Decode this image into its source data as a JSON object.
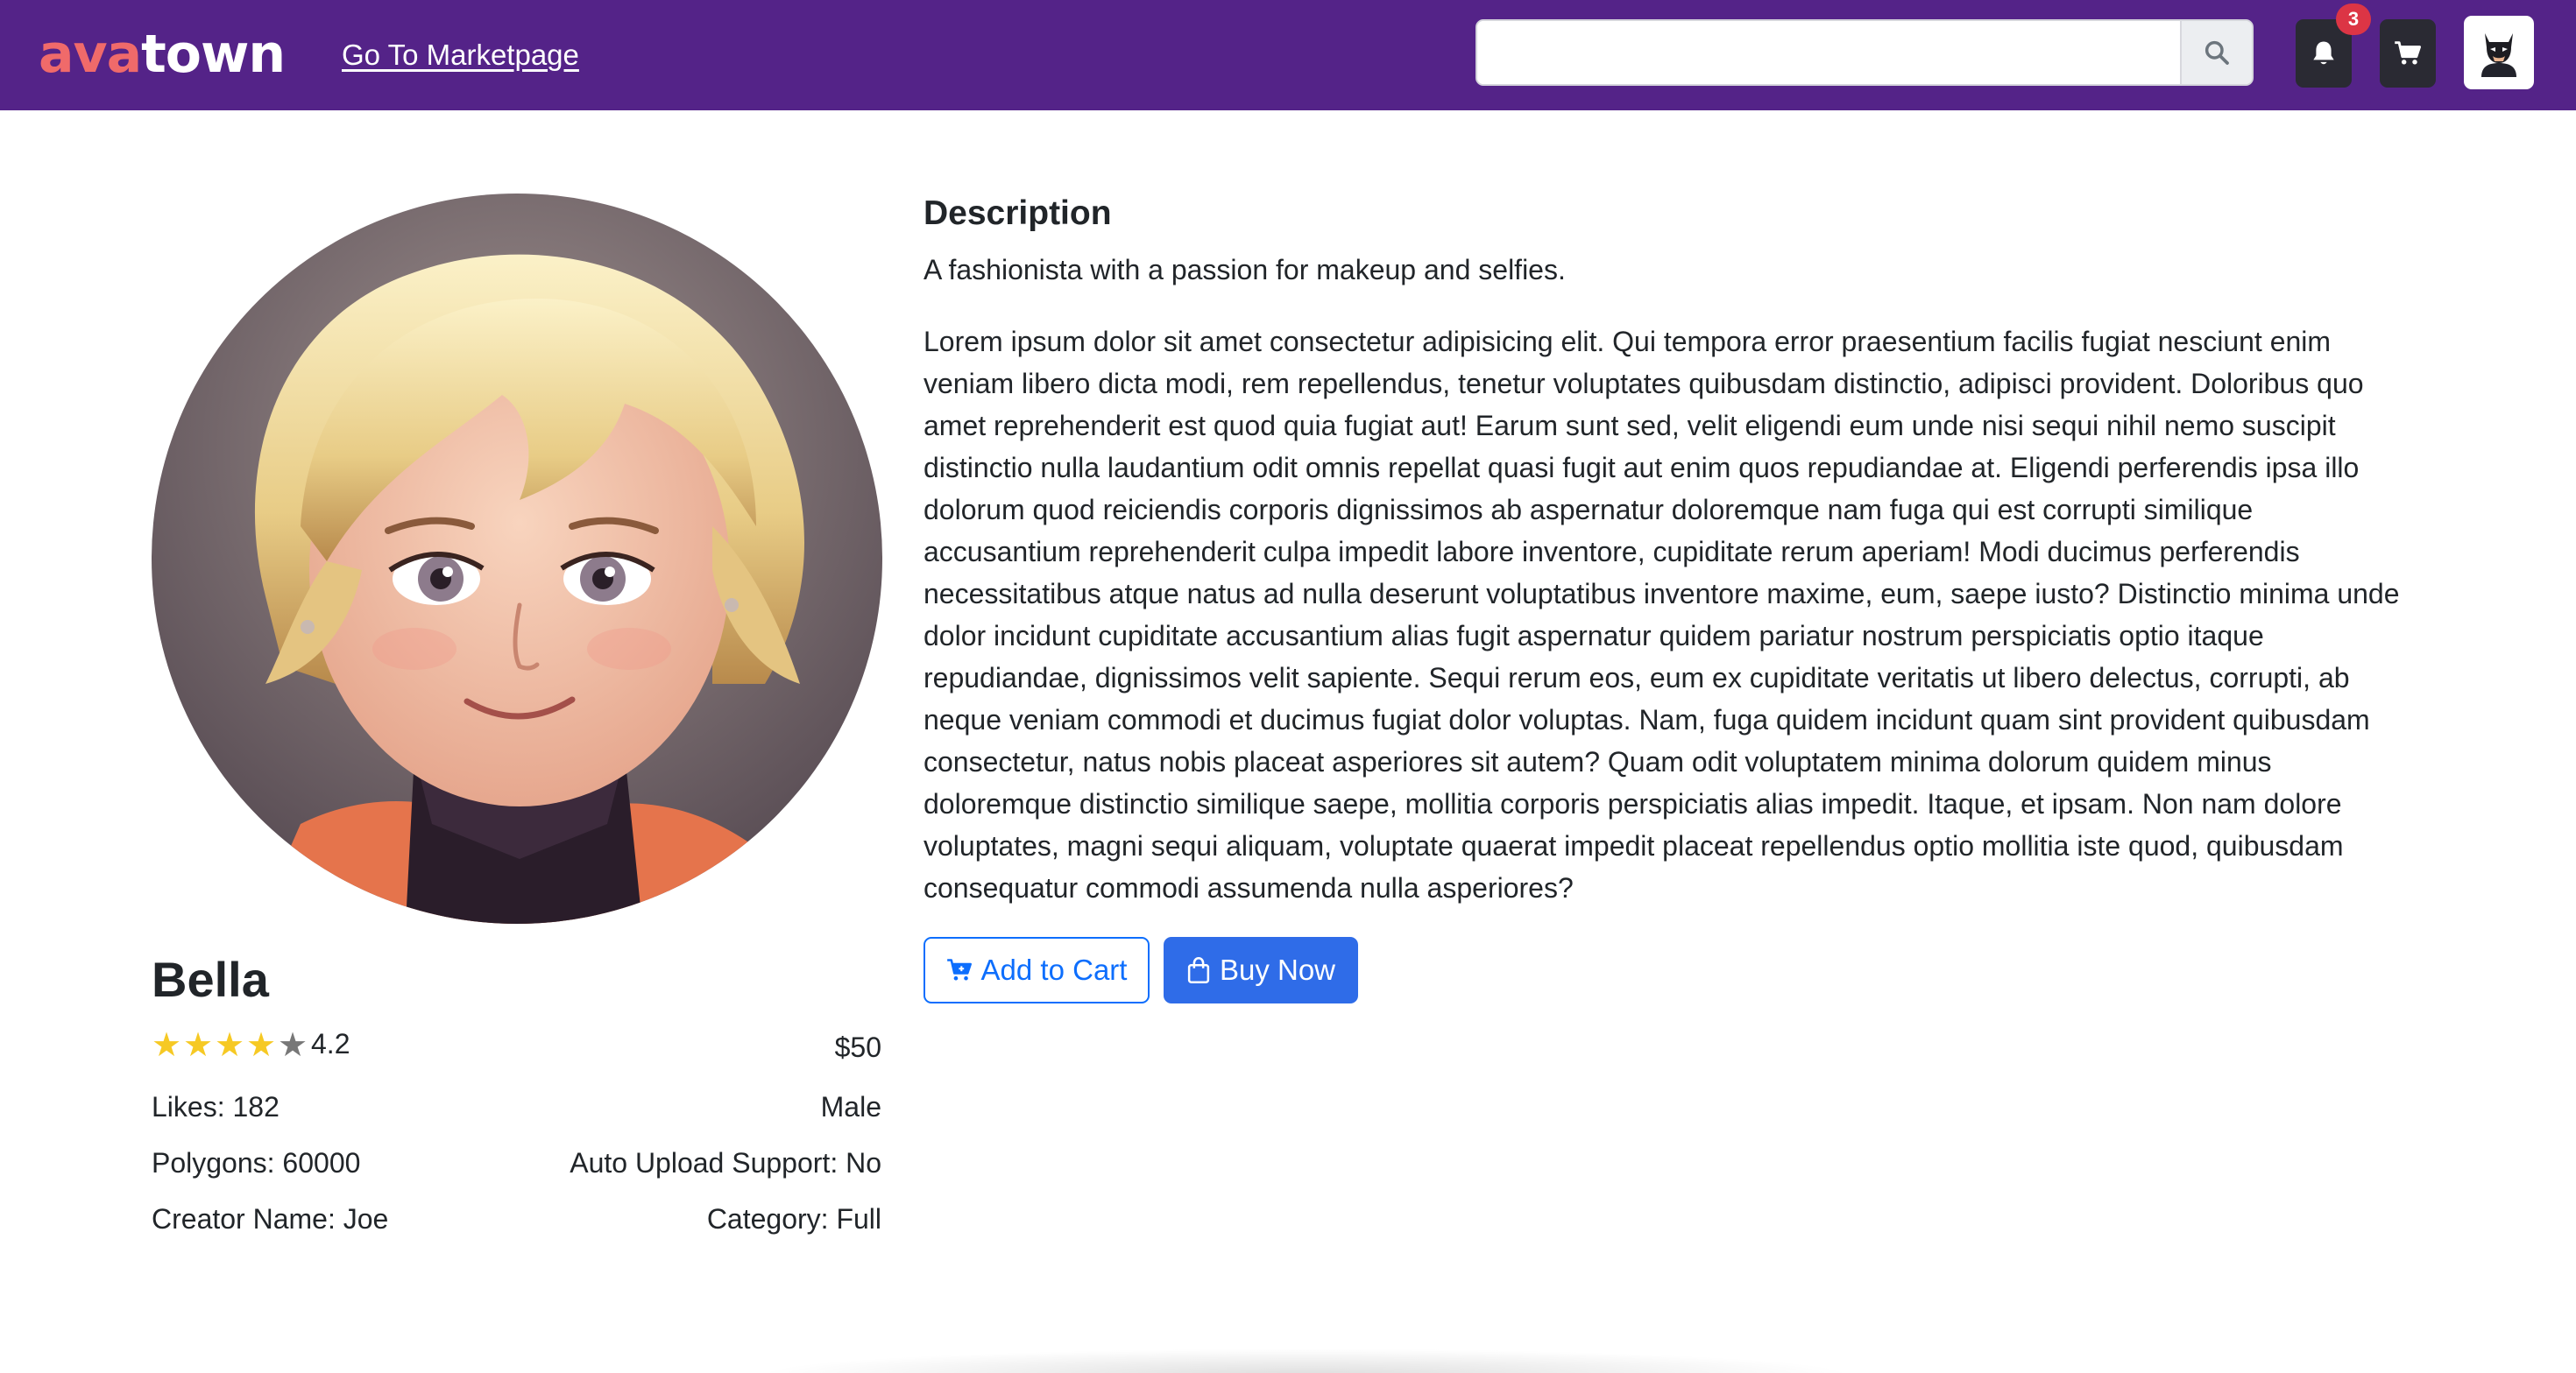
{
  "colors": {
    "navbar": "#542388",
    "logo_accent": "#f06a6a",
    "primary": "#0d6efd",
    "badge": "#dc3545",
    "star_on": "#f6c924",
    "star_off": "#777777"
  },
  "header": {
    "logo_part1": "ava",
    "logo_part2": "town",
    "marketplace_link": "Go To Marketpage",
    "search": {
      "value": "",
      "placeholder": "",
      "icon": "search-icon"
    },
    "notifications": {
      "icon": "bell-icon",
      "count": "3"
    },
    "cart": {
      "icon": "cart-icon"
    },
    "user_avatar": {
      "icon": "batman-avatar-icon"
    }
  },
  "product": {
    "name": "Bella",
    "rating": 4.2,
    "rating_label": "4.2",
    "rating_max": 5,
    "stars_filled": 4,
    "price": "$50",
    "likes": "Likes: 182",
    "gender": "Male",
    "polygons": "Polygons: 60000",
    "auto_upload": "Auto Upload Support: No",
    "creator": "Creator Name: Joe",
    "category": "Category: Full",
    "image": "cartoon-avatar-portrait"
  },
  "description": {
    "title": "Description",
    "tagline": "A fashionista with a passion for makeup and selfies.",
    "body": "Lorem ipsum dolor sit amet consectetur adipisicing elit. Qui tempora error praesentium facilis fugiat nesciunt enim veniam libero dicta modi, rem repellendus, tenetur voluptates quibusdam distinctio, adipisci provident. Doloribus quo amet reprehenderit est quod quia fugiat aut! Earum sunt sed, velit eligendi eum unde nisi sequi nihil nemo suscipit distinctio nulla laudantium odit omnis repellat quasi fugit aut enim quos repudiandae at. Eligendi perferendis ipsa illo dolorum quod reiciendis corporis dignissimos ab aspernatur doloremque nam fuga qui est corrupti similique accusantium reprehenderit culpa impedit labore inventore, cupiditate rerum aperiam! Modi ducimus perferendis necessitatibus atque natus ad nulla deserunt voluptatibus inventore maxime, eum, saepe iusto? Distinctio minima unde dolor incidunt cupiditate accusantium alias fugit aspernatur quidem pariatur nostrum perspiciatis optio itaque repudiandae, dignissimos velit sapiente. Sequi rerum eos, eum ex cupiditate veritatis ut libero delectus, corrupti, ab neque veniam commodi et ducimus fugiat dolor voluptas. Nam, fuga quidem incidunt quam sint provident quibusdam consectetur, natus nobis placeat asperiores sit autem? Quam odit voluptatem minima dolorum quidem minus doloremque distinctio similique saepe, mollitia corporis perspiciatis alias impedit. Itaque, et ipsam. Non nam dolore voluptates, magni sequi aliquam, voluptate quaerat impedit placeat repellendus optio mollitia iste quod, quibusdam consequatur commodi assumenda nulla asperiores?"
  },
  "actions": {
    "add_to_cart": "Add to Cart",
    "add_to_cart_icon": "cart-plus-icon",
    "buy_now": "Buy Now",
    "buy_now_icon": "shopping-bag-icon"
  }
}
